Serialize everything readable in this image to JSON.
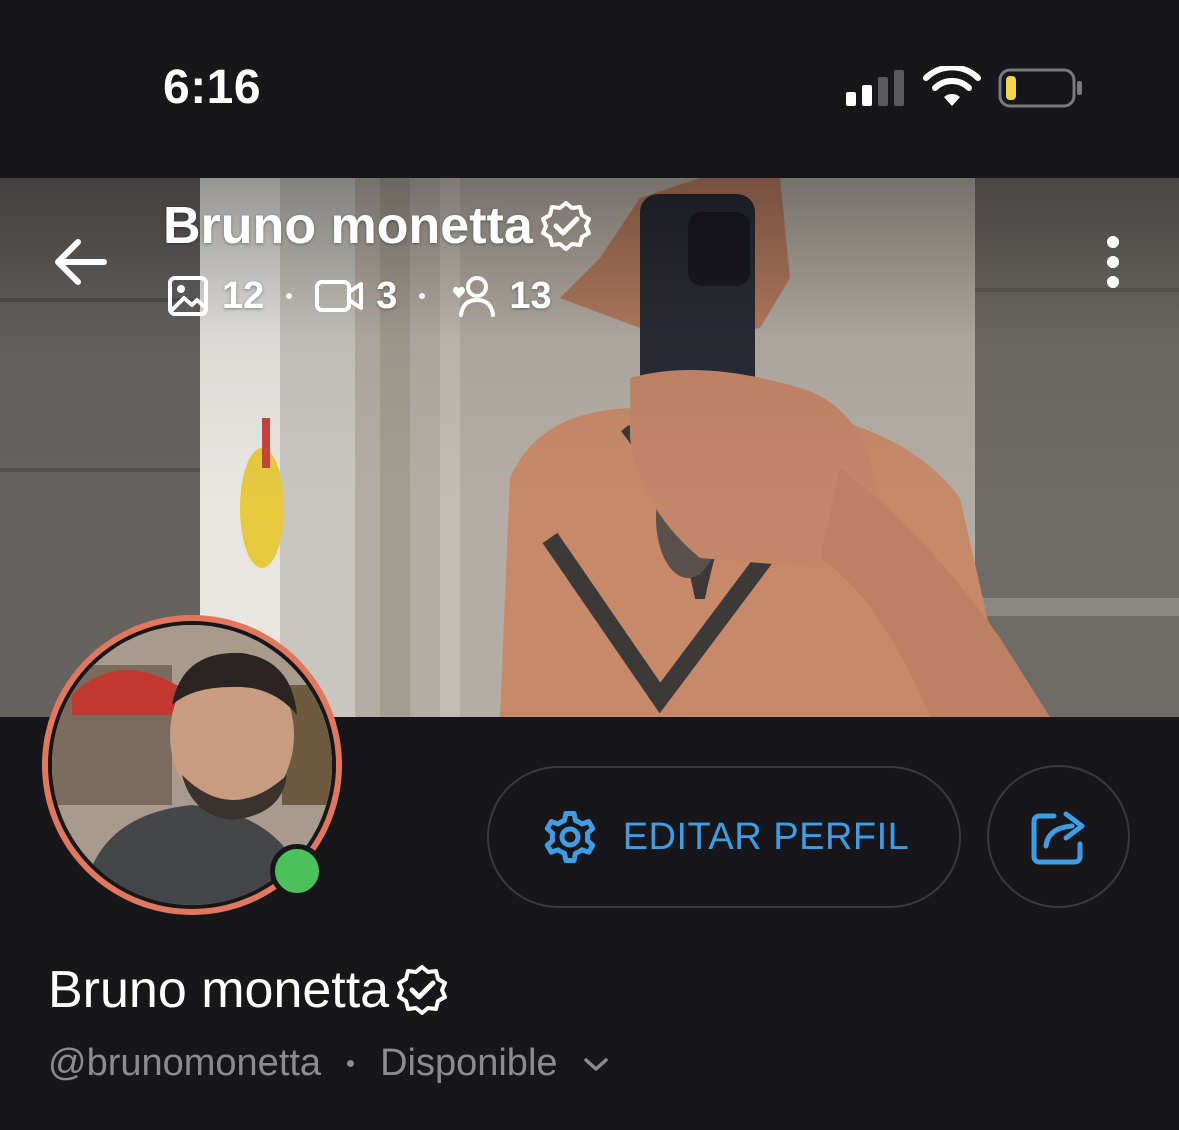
{
  "status_bar": {
    "time": "6:16"
  },
  "profile": {
    "name": "Bruno monetta",
    "handle": "@brunomonetta",
    "availability": "Disponible",
    "stats": {
      "photos": "12",
      "videos": "3",
      "followers": "13"
    }
  },
  "actions": {
    "edit_label": "EDITAR PERFIL"
  },
  "colors": {
    "accent": "#3d9ee5",
    "background": "#17171a",
    "online": "#4cc15a",
    "avatar_ring": "#e2775e",
    "battery_low": "#f5d547"
  },
  "icons": [
    "back-arrow-icon",
    "more-vertical-icon",
    "image-icon",
    "video-icon",
    "followers-icon",
    "verified-icon",
    "gear-icon",
    "share-icon",
    "chevron-down-icon",
    "signal-icon",
    "wifi-icon",
    "battery-icon"
  ]
}
